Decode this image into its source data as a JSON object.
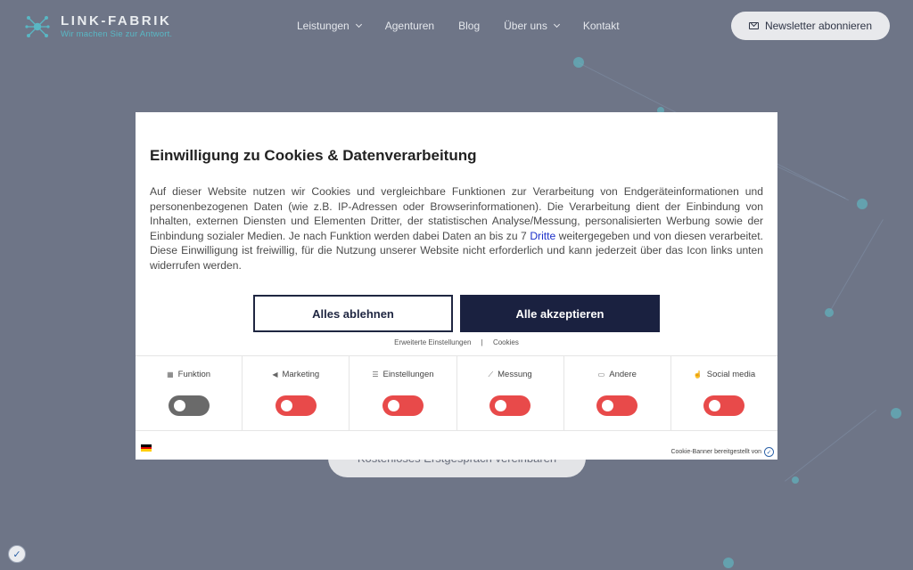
{
  "header": {
    "logo_name": "LINK-FABRIK",
    "logo_tagline": "Wir machen Sie zur Antwort.",
    "nav": [
      {
        "label": "Leistungen"
      },
      {
        "label": "Agenturen"
      },
      {
        "label": "Blog"
      },
      {
        "label": "Über uns"
      },
      {
        "label": "Kontakt"
      }
    ],
    "newsletter_label": "Newsletter abonnieren"
  },
  "hero": {
    "cta_label": "Kostenloses Erstgespräch vereinbaren"
  },
  "cookie_modal": {
    "title": "Einwilligung zu Cookies & Datenverarbeitung",
    "text_before_link": "Auf dieser Website nutzen wir Cookies und vergleichbare Funktionen zur Verarbeitung von Endgeräteinformationen und personenbezogenen Daten (wie z.B. IP-Adressen oder Browserinformationen). Die Verarbeitung dient der Einbindung von Inhalten, externen Diensten und Elementen Dritter, der statistischen Analyse/Messung, personalisierten Werbung sowie der Einbindung sozialer Medien. Je nach Funktion werden dabei Daten an bis zu 7 ",
    "link_text": "Dritte",
    "text_after_link": " weitergegeben und von diesen verarbeitet. Diese Einwilligung ist freiwillig, für die Nutzung unserer Website nicht erforderlich und kann jederzeit über das Icon links unten widerrufen werden.",
    "decline_label": "Alles ablehnen",
    "accept_label": "Alle akzeptieren",
    "settings_link": "Erweiterte Einstellungen",
    "separator": "|",
    "cookies_link": "Cookies",
    "categories": [
      {
        "label": "Funktion",
        "icon": "grid-icon",
        "enabled": true
      },
      {
        "label": "Marketing",
        "icon": "megaphone-icon",
        "enabled": false
      },
      {
        "label": "Einstellungen",
        "icon": "sliders-icon",
        "enabled": false
      },
      {
        "label": "Messung",
        "icon": "chart-icon",
        "enabled": false
      },
      {
        "label": "Andere",
        "icon": "chat-icon",
        "enabled": false
      },
      {
        "label": "Social media",
        "icon": "thumbs-up-icon",
        "enabled": false
      }
    ],
    "provided_by": "Cookie-Banner bereitgestellt von"
  },
  "colors": {
    "backdrop": "#6e7587",
    "accent_teal": "#59b7c4",
    "primary_dark": "#1a2140",
    "toggle_off": "#e84a4a",
    "toggle_on": "#6a6a6a"
  }
}
